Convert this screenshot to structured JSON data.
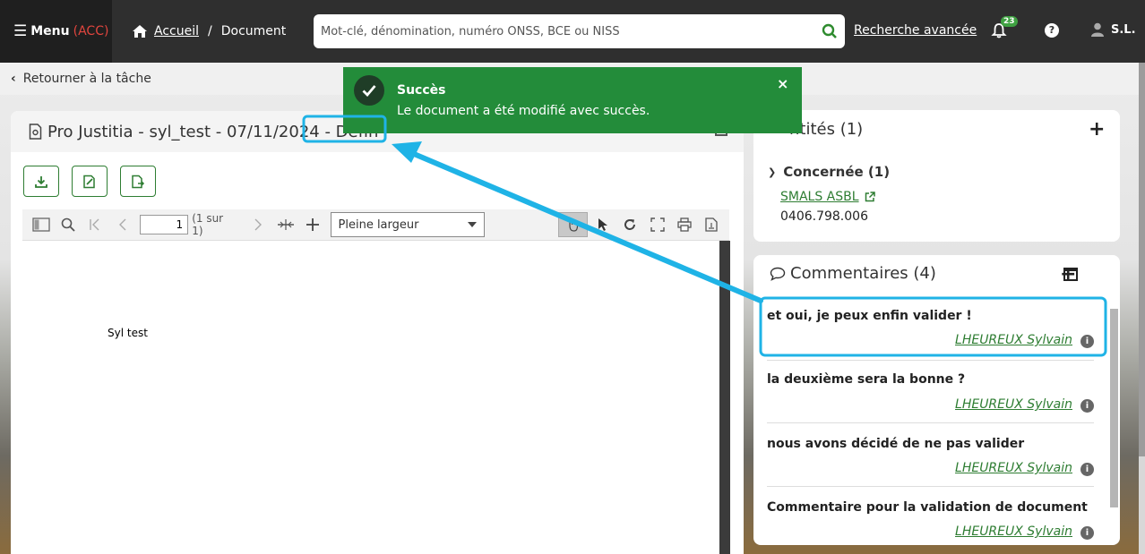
{
  "header": {
    "menu_label": "Menu",
    "env_label": "(ACC)",
    "breadcrumb": {
      "home": "Accueil",
      "separator": "/",
      "current": "Document"
    },
    "search_placeholder": "Mot-clé, dénomination, numéro ONSS, BCE ou NISS",
    "advanced_search": "Recherche avancée",
    "notification_count": "23",
    "help_label": "?",
    "user_initials": "S.L."
  },
  "back_link": "Retourner à la tâche",
  "document": {
    "title": "Pro Justitia - syl_test - 07/11/2024 - Défin",
    "viewer": {
      "page_value": "1",
      "page_count": "(1 sur 1)",
      "zoom": "Pleine largeur",
      "content_text": "Syl test"
    }
  },
  "entities": {
    "title": "ntités (1)",
    "group_label": "Concernée (1)",
    "entity_name": "SMALS ASBL",
    "entity_number": "0406.798.006"
  },
  "comments": {
    "title": "Commentaires (4)",
    "items": [
      {
        "text": "et oui, je peux enfin valider !",
        "author": "LHEUREUX Sylvain"
      },
      {
        "text": "la deuxième sera la bonne ?",
        "author": "LHEUREUX Sylvain"
      },
      {
        "text": "nous avons décidé de ne pas valider",
        "author": "LHEUREUX Sylvain"
      },
      {
        "text": "Commentaire pour la validation de document",
        "author": "LHEUREUX Sylvain"
      }
    ]
  },
  "toast": {
    "title": "Succès",
    "message": "Le document a été modifié avec succès.",
    "close": "×"
  },
  "colors": {
    "topbar": "#2f2f2f",
    "accent_green": "#2e7d32",
    "toast_green": "#238c3a",
    "annotation_blue": "#1fb3e6",
    "env_red": "#e0453e"
  }
}
